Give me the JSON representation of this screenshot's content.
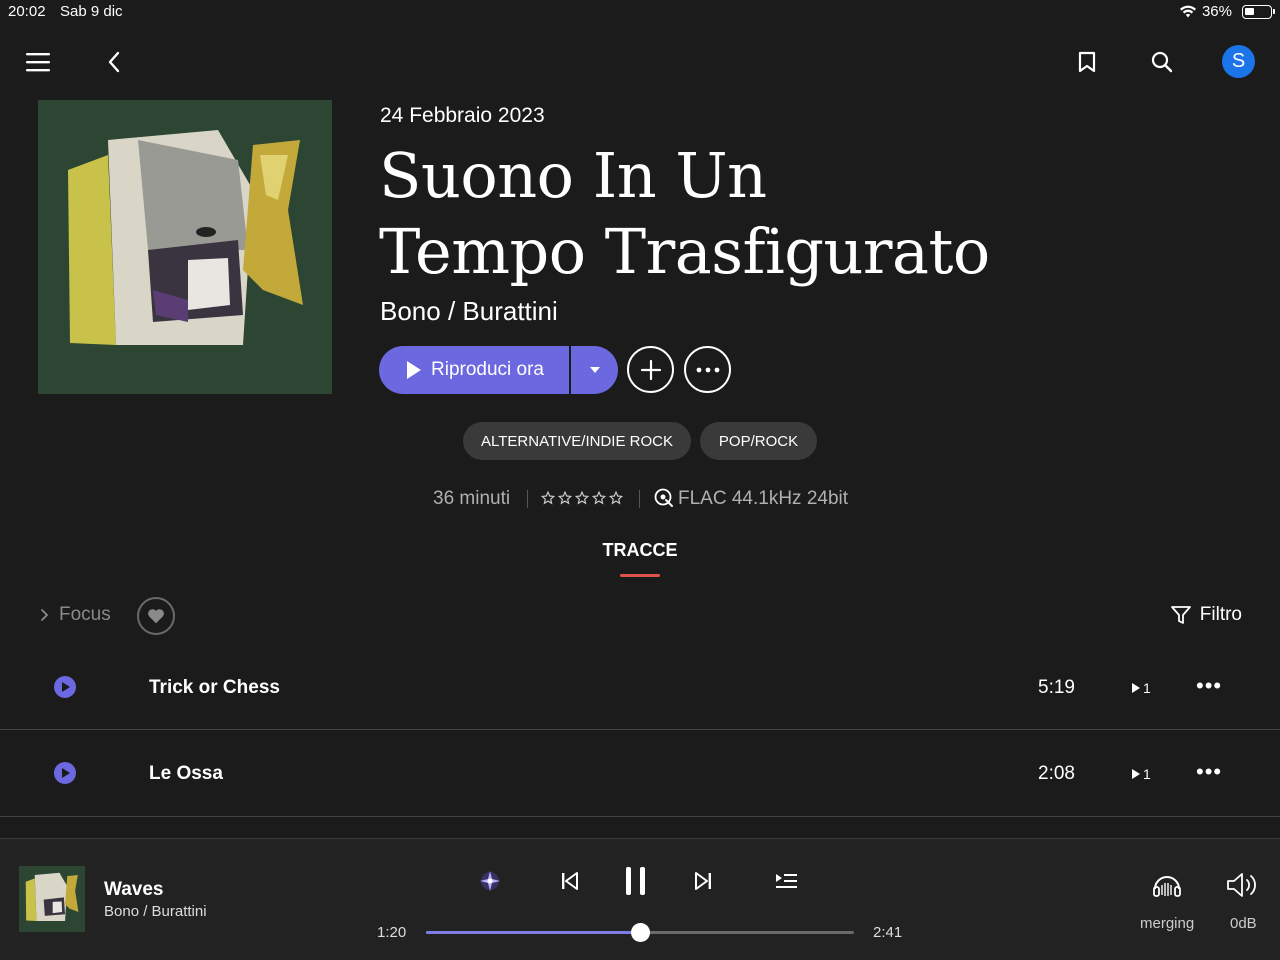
{
  "status_bar": {
    "time": "20:02",
    "date": "Sab 9 dic",
    "battery": "36%",
    "battery_level": 0.36
  },
  "nav": {
    "menu_icon": "menu-icon",
    "back_icon": "chevron-left-icon",
    "bookmark_icon": "bookmark-icon",
    "search_icon": "search-icon",
    "avatar_letter": "S"
  },
  "album": {
    "release_date": "24 Febbraio 2023",
    "title_line1": "Suono In Un",
    "title_line2": "Tempo Trasfigurato",
    "artist": "Bono / Burattini",
    "play_label": "Riproduci ora",
    "genres": [
      "ALTERNATIVE/INDIE ROCK",
      "POP/ROCK"
    ],
    "duration": "36 minuti",
    "rating": 0,
    "format": "FLAC 44.1kHz 24bit"
  },
  "tabs": {
    "active": "TRACCE"
  },
  "toolbar": {
    "focus_label": "Focus",
    "filter_label": "Filtro"
  },
  "tracks": [
    {
      "name": "Trick or Chess",
      "duration": "5:19",
      "plays": "1"
    },
    {
      "name": "Le Ossa",
      "duration": "2:08",
      "plays": "1"
    }
  ],
  "player": {
    "title": "Waves",
    "artist": "Bono / Burattini",
    "elapsed": "1:20",
    "total": "2:41",
    "progress": 0.5,
    "output_label": "merging",
    "volume_label": "0dB"
  },
  "colors": {
    "accent": "#6c68e0",
    "tab_underline": "#e0524a",
    "avatar": "#1b74e8",
    "background": "#1b1b1b"
  }
}
